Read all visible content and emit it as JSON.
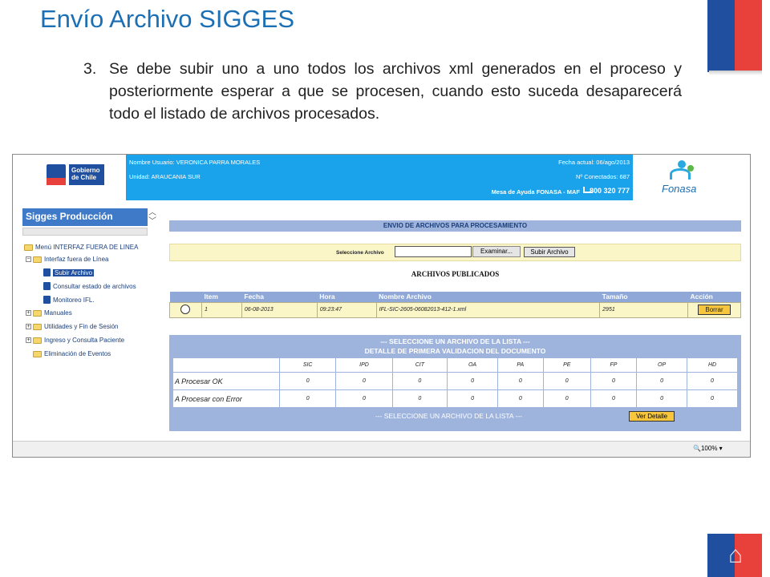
{
  "slide": {
    "title": "Envío Archivo SIGGES",
    "bullet_number": "3.",
    "bullet_text": "Se debe subir uno a uno todos los archivos xml generados en el proceso y posteriormente esperar a que se procesen, cuando esto suceda desaparecerá todo el listado de archivos procesados."
  },
  "header": {
    "gobierno_logo_text": "Gobierno de Chile",
    "user_label": "Nombre Usuario: VERONICA PARRA MORALES",
    "unit_label": "Unidad: ARAUCANIA SUR",
    "date_label": "Fecha actual: 06/ago/2013",
    "connected_label": "Nº Conectados: 687",
    "help_label": "Mesa de Ayuda FONASA - MAF",
    "help_phone": "800 320 777",
    "fonasa_logo_text": "Fonasa"
  },
  "sidebar": {
    "title": "Sigges Producción",
    "items": [
      {
        "label": "Menú INTERFAZ FUERA DE LINEA"
      },
      {
        "label": "Interfaz fuera de Línea"
      },
      {
        "label": "Subir Archivo"
      },
      {
        "label": "Consultar estado de archivos"
      },
      {
        "label": "Monitoreo IFL."
      },
      {
        "label": "Manuales"
      },
      {
        "label": "Utilidades y Fin de Sesión"
      },
      {
        "label": "Ingreso y Consulta Paciente"
      },
      {
        "label": "Eliminación de Eventos"
      }
    ]
  },
  "main": {
    "title": "ENVIO DE ARCHIVOS PARA PROCESAMIENTO",
    "select_label": "Seleccione Archivo",
    "browse_button": "Examinar...",
    "upload_button": "Subir Archivo",
    "published_title": "ARCHIVOS PUBLICADOS",
    "files_columns": [
      "Item",
      "Fecha",
      "Hora",
      "Nombre Archivo",
      "Tamaño",
      "Acción"
    ],
    "files_rows": [
      {
        "item": "1",
        "fecha": "06-08-2013",
        "hora": "09:23:47",
        "nombre": "IFL-SIC-2605-06082013-412-1.xml",
        "tamano": "2951",
        "accion": "Borrar"
      }
    ],
    "detail_header_1": "--- SELECCIONE UN ARCHIVO DE LA LISTA ---",
    "detail_header_2": "DETALLE DE PRIMERA VALIDACION DEL DOCUMENTO",
    "detail_columns": [
      "SIC",
      "IPD",
      "CIT",
      "OA",
      "PA",
      "PE",
      "FP",
      "OP",
      "HD"
    ],
    "detail_rows": [
      {
        "label": "A Procesar OK",
        "values": [
          "0",
          "0",
          "0",
          "0",
          "0",
          "0",
          "0",
          "0",
          "0"
        ]
      },
      {
        "label": "A Procesar con Error",
        "values": [
          "0",
          "0",
          "0",
          "0",
          "0",
          "0",
          "0",
          "0",
          "0"
        ]
      }
    ],
    "detail_footer": "--- SELECCIONE UN ARCHIVO DE LA LISTA ---",
    "detail_button": "Ver Detalle"
  },
  "statusbar": {
    "zoom": "100%"
  }
}
